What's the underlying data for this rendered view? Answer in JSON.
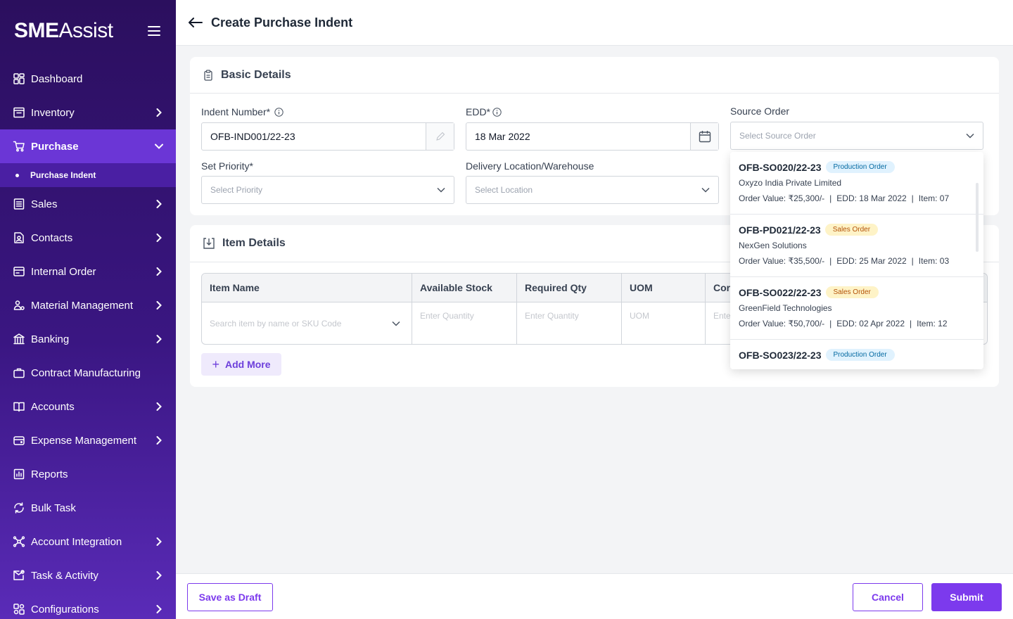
{
  "app": {
    "logo_bold": "SME",
    "logo_light": "Assist"
  },
  "sidebar": {
    "items": [
      {
        "label": "Dashboard",
        "icon": "dashboard-icon",
        "chevron": false
      },
      {
        "label": "Inventory",
        "icon": "inventory-icon",
        "chevron": true
      },
      {
        "label": "Purchase",
        "icon": "cart-icon",
        "chevron": true,
        "active": true
      },
      {
        "label": "Sales",
        "icon": "sales-icon",
        "chevron": true
      },
      {
        "label": "Contacts",
        "icon": "contacts-icon",
        "chevron": true
      },
      {
        "label": "Internal Order",
        "icon": "internal-order-icon",
        "chevron": true
      },
      {
        "label": "Material Management",
        "icon": "material-icon",
        "chevron": true
      },
      {
        "label": "Banking",
        "icon": "bank-icon",
        "chevron": true
      },
      {
        "label": "Contract Manufacturing",
        "icon": "briefcase-icon",
        "chevron": false
      },
      {
        "label": "Accounts",
        "icon": "book-icon",
        "chevron": true
      },
      {
        "label": "Expense Management",
        "icon": "wallet-icon",
        "chevron": true
      },
      {
        "label": "Reports",
        "icon": "reports-icon",
        "chevron": false
      },
      {
        "label": "Bulk Task",
        "icon": "refresh-icon",
        "chevron": false
      },
      {
        "label": "Account Integration",
        "icon": "network-icon",
        "chevron": true
      },
      {
        "label": "Task & Activity",
        "icon": "task-icon",
        "chevron": true
      },
      {
        "label": "Configurations",
        "icon": "config-icon",
        "chevron": true
      }
    ],
    "sub_item": "Purchase Indent"
  },
  "header": {
    "title": "Create Purchase Indent"
  },
  "basic": {
    "title": "Basic Details",
    "indent_label": "Indent Number*",
    "indent_value": "OFB-IND001/22-23",
    "edd_label": "EDD*",
    "edd_value": "18 Mar 2022",
    "source_label": "Source Order",
    "source_placeholder": "Select Source Order",
    "priority_label": "Set Priority*",
    "priority_placeholder": "Select Priority",
    "location_label": "Delivery Location/Warehouse",
    "location_placeholder": "Select Location"
  },
  "items": {
    "title": "Item Details",
    "columns": [
      "Item Name",
      "Available Stock",
      "Required Qty",
      "UOM",
      "Cor"
    ],
    "row": {
      "search_placeholder": "Search item by name or SKU Code",
      "available_ph": "Enter Quantity",
      "required_ph": "Enter Quantity",
      "uom_ph": "UOM",
      "cor_ph": "Ente"
    },
    "add_more": "Add More"
  },
  "dropdown": {
    "options": [
      {
        "code": "OFB-SO020/22-23",
        "badge": "Production Order",
        "type": "production",
        "name": "Oxyzo India Private Limited",
        "value": "Order Value: ₹25,300/-",
        "edd": "EDD: 18 Mar 2022",
        "items": "Item: 07"
      },
      {
        "code": "OFB-PD021/22-23",
        "badge": "Sales Order",
        "type": "sales",
        "name": "NexGen Solutions",
        "value": "Order Value: ₹35,500/-",
        "edd": "EDD: 25 Mar 2022",
        "items": "Item: 03"
      },
      {
        "code": "OFB-SO022/22-23",
        "badge": "Sales Order",
        "type": "sales",
        "name": "GreenField Technologies",
        "value": "Order Value: ₹50,700/-",
        "edd": "EDD: 02 Apr 2022",
        "items": "Item: 12"
      },
      {
        "code": "OFB-SO023/22-23",
        "badge": "Production Order",
        "type": "production",
        "name": "",
        "value": "",
        "edd": "",
        "items": ""
      }
    ],
    "separator": "|"
  },
  "footer": {
    "draft": "Save as Draft",
    "cancel": "Cancel",
    "submit": "Submit"
  },
  "colors": {
    "primary": "#7c3aed",
    "sidebar_top": "#2b0f5e",
    "active": "#6b36d6"
  }
}
